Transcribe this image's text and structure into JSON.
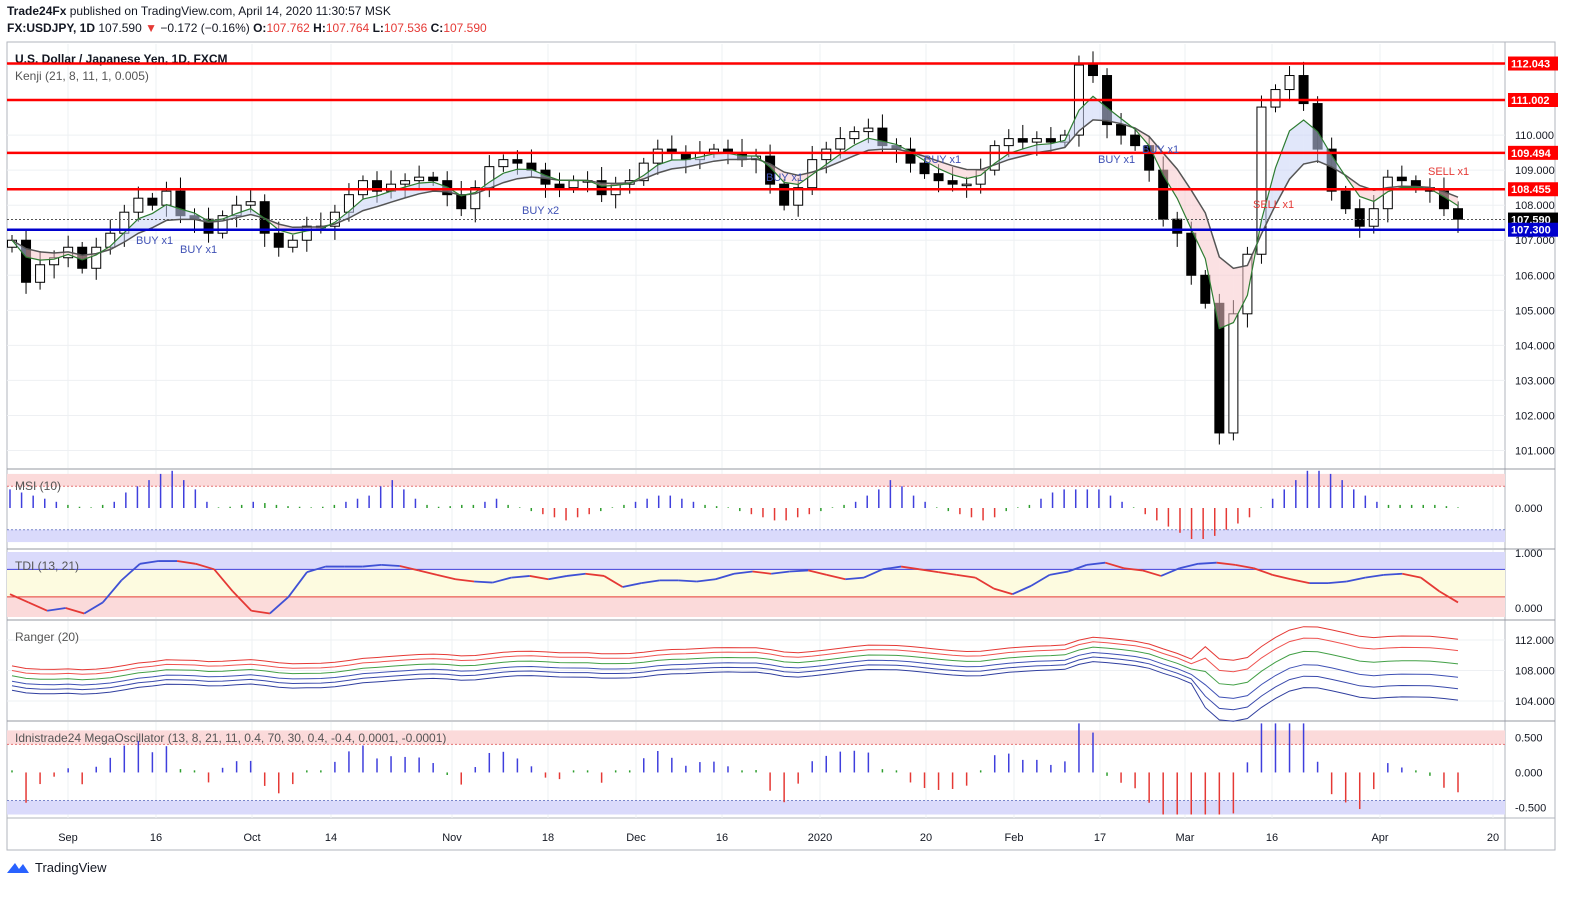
{
  "header": {
    "publisher": "Trade24Fx",
    "published_text": "published on TradingView.com, April 14, 2020 11:30:57 MSK",
    "symbol": "FX:USDJPY, 1D",
    "last": "107.590",
    "change_arrow": "▼",
    "change": "−0.172 (−0.16%)",
    "o_label": "O:",
    "o": "107.762",
    "h_label": "H:",
    "h": "107.764",
    "l_label": "L:",
    "l": "107.536",
    "c_label": "C:",
    "c": "107.590"
  },
  "main_pane": {
    "title": "U.S. Dollar / Japanese Yen, 1D, FXCM",
    "indicator": "Kenji (21, 8, 11, 1, 0.005)"
  },
  "footer": {
    "brand": "TradingView",
    "logo_icon": "tradingview-logo-icon"
  },
  "colors": {
    "up": "#ffffff",
    "down": "#000000",
    "level_red": "#ff0000",
    "level_blue": "#0000cc",
    "ema_fast": "#2e7d32",
    "buy": "#3f51b5",
    "sell": "#e53935"
  },
  "chart_data": [
    {
      "type": "candlestick",
      "ylim": [
        100.5,
        112.6
      ],
      "y_ticks": [
        "112.000",
        "111.000",
        "110.000",
        "109.000",
        "108.000",
        "107.000",
        "106.000",
        "105.000",
        "104.000",
        "103.000",
        "102.000",
        "101.000"
      ],
      "x_ticks": [
        "Sep",
        "16",
        "Oct",
        "14",
        "Nov",
        "18",
        "Dec",
        "16",
        "2020",
        "20",
        "Feb",
        "17",
        "Mar",
        "16",
        "Apr",
        "20"
      ],
      "levels": [
        {
          "value": 112.043,
          "label": "112.043",
          "color": "#ff0000"
        },
        {
          "value": 111.002,
          "label": "111.002",
          "color": "#ff0000"
        },
        {
          "value": 109.494,
          "label": "109.494",
          "color": "#ff0000"
        },
        {
          "value": 108.455,
          "label": "108.455",
          "color": "#ff0000"
        },
        {
          "value": 107.59,
          "label": "107.590",
          "color": "#000000"
        },
        {
          "value": 107.3,
          "label": "107.300",
          "color": "#0000cc"
        }
      ],
      "close_anchors": [
        107.0,
        105.8,
        106.3,
        106.5,
        106.8,
        106.2,
        106.8,
        107.2,
        107.8,
        108.2,
        108.0,
        108.4,
        107.7,
        107.6,
        107.2,
        107.7,
        108.0,
        108.1,
        107.2,
        106.8,
        107.0,
        107.4,
        107.4,
        107.8,
        108.3,
        108.7,
        108.4,
        108.6,
        108.7,
        108.8,
        108.7,
        108.3,
        107.9,
        108.5,
        109.1,
        109.3,
        109.2,
        109.0,
        108.6,
        108.5,
        108.7,
        108.7,
        108.3,
        108.6,
        108.7,
        109.2,
        109.6,
        109.5,
        109.3,
        109.5,
        109.6,
        109.5,
        109.3,
        109.4,
        108.6,
        108.0,
        108.5,
        109.3,
        109.6,
        109.9,
        110.1,
        110.2,
        109.7,
        109.6,
        109.2,
        108.9,
        108.7,
        108.6,
        108.6,
        109.0,
        109.7,
        109.9,
        109.8,
        109.9,
        109.8,
        110.0,
        112.0,
        111.7,
        110.3,
        110.0,
        109.7,
        109.0,
        107.6,
        107.2,
        106.0,
        105.2,
        101.5,
        104.9,
        106.6,
        110.8,
        111.3,
        111.7,
        110.9,
        109.6,
        108.4,
        107.9,
        107.4,
        107.9,
        108.8,
        108.7,
        108.5,
        108.4,
        107.9,
        107.6
      ],
      "signals": [
        {
          "text": "BUY x1",
          "date": "Sep 12",
          "side": "buy"
        },
        {
          "text": "BUY x1",
          "date": "Sep 26",
          "side": "buy"
        },
        {
          "text": "BUY x2",
          "date": "Nov 18",
          "side": "buy"
        },
        {
          "text": "BUY x1",
          "date": "Dec 26",
          "side": "buy"
        },
        {
          "text": "BUY x1",
          "date": "Jan 21",
          "side": "buy"
        },
        {
          "text": "BUY x1",
          "date": "Feb 18",
          "side": "buy"
        },
        {
          "text": "BUY x1",
          "date": "Feb 24",
          "side": "buy"
        },
        {
          "text": "SELL x1",
          "date": "Mar 13",
          "side": "sell"
        },
        {
          "text": "SELL x1",
          "date": "Apr 8",
          "side": "sell"
        }
      ]
    },
    {
      "type": "histogram",
      "title": "MSI (10)",
      "y_ticks": [
        "0.000"
      ],
      "band": [
        -0.5,
        0.5
      ],
      "values": [
        0.3,
        0.25,
        0.2,
        0.15,
        0.1,
        0.05,
        0.02,
        0.0,
        0.05,
        0.1,
        0.25,
        0.35,
        0.45,
        0.55,
        0.6,
        0.45,
        0.3,
        0.1,
        0.0,
        0.02,
        0.05,
        0.1,
        0.08,
        0.05,
        0.03,
        0.02,
        0.0,
        0.02,
        0.05,
        0.1,
        0.15,
        0.2,
        0.35,
        0.45,
        0.3,
        0.15,
        0.05,
        0.02,
        0.03,
        0.05,
        0.05,
        0.1,
        0.15,
        0.05,
        0.0,
        -0.05,
        -0.1,
        -0.15,
        -0.2,
        -0.15,
        -0.1,
        -0.05,
        0.0,
        0.05,
        0.1,
        0.15,
        0.2,
        0.2,
        0.15,
        0.1,
        0.05,
        0.03,
        0.0,
        -0.05,
        -0.1,
        -0.15,
        -0.2,
        -0.2,
        -0.15,
        -0.1,
        -0.05,
        0.0,
        0.05,
        0.1,
        0.2,
        0.3,
        0.45,
        0.35,
        0.2,
        0.1,
        0.0,
        -0.05,
        -0.1,
        -0.15,
        -0.2,
        -0.15,
        -0.05,
        0.0,
        0.05,
        0.15,
        0.25,
        0.3,
        0.3,
        0.3,
        0.3,
        0.2,
        0.1,
        0.0,
        -0.1,
        -0.2,
        -0.3,
        -0.4,
        -0.5,
        -0.5,
        -0.45,
        -0.35,
        -0.25,
        -0.15,
        0.0,
        0.15,
        0.3,
        0.45,
        0.6,
        0.6,
        0.55,
        0.45,
        0.3,
        0.2,
        0.1,
        0.05,
        0.05,
        0.05,
        0.05,
        0.05,
        0.03,
        0.0
      ]
    },
    {
      "type": "line",
      "title": "TDI (13, 21)",
      "y_ticks": [
        "1.000",
        "0.000"
      ],
      "ylim": [
        -0.2,
        1.05
      ],
      "values": [
        0.25,
        0.1,
        -0.05,
        0.0,
        -0.1,
        0.1,
        0.5,
        0.8,
        0.85,
        0.85,
        0.8,
        0.7,
        0.3,
        -0.05,
        -0.1,
        0.2,
        0.65,
        0.75,
        0.75,
        0.75,
        0.78,
        0.76,
        0.68,
        0.6,
        0.52,
        0.48,
        0.46,
        0.55,
        0.58,
        0.52,
        0.58,
        0.62,
        0.58,
        0.38,
        0.45,
        0.5,
        0.5,
        0.48,
        0.52,
        0.62,
        0.66,
        0.62,
        0.66,
        0.68,
        0.6,
        0.52,
        0.55,
        0.7,
        0.75,
        0.7,
        0.65,
        0.6,
        0.55,
        0.35,
        0.25,
        0.4,
        0.6,
        0.66,
        0.78,
        0.82,
        0.72,
        0.68,
        0.58,
        0.72,
        0.8,
        0.82,
        0.78,
        0.72,
        0.6,
        0.52,
        0.45,
        0.45,
        0.48,
        0.55,
        0.6,
        0.62,
        0.55,
        0.3,
        0.1
      ]
    },
    {
      "type": "line",
      "title": "Ranger (20)",
      "y_ticks": [
        "112.000",
        "108.000",
        "104.000"
      ],
      "ylim": [
        101.5,
        114.5
      ]
    },
    {
      "type": "histogram",
      "title": "Idnistrade24 MegaOscillator (13, 8, 21, 11, 0.4, 70, 30, 0.4, -0.4, 0.0001, -0.0001)",
      "y_ticks": [
        "0.500",
        "0.000",
        "-0.500"
      ],
      "ylim": [
        -0.65,
        0.72
      ]
    }
  ]
}
